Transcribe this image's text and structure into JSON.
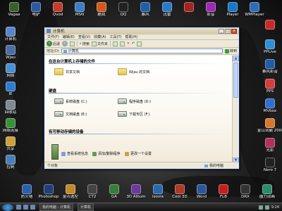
{
  "desktop": {
    "top_icons": [
      {
        "label": "Vagaa",
        "color": "#3a5f2e"
      },
      {
        "label": "电驴",
        "color": "#2c5aa0"
      },
      {
        "label": "Qvod",
        "color": "#c43c2a"
      },
      {
        "label": "MSN",
        "color": "#3b7fc4"
      },
      {
        "label": "酷我",
        "color": "#d35a1c"
      },
      {
        "label": "QQ",
        "color": "#222222"
      },
      {
        "label": "暴风",
        "color": "#1f5fa5"
      },
      {
        "label": "迅雷",
        "color": "#2a79c9"
      },
      {
        "label": "",
        "color": "#a3241e"
      },
      {
        "label": "影音",
        "color": "#9b2bb0"
      },
      {
        "label": "Player",
        "color": "#1878c8"
      },
      {
        "label": "WMPlayer",
        "color": "#2d6db5"
      }
    ],
    "left_icons": [
      {
        "label": "计算机",
        "color": "#5a86c8"
      },
      {
        "label": "Wjau",
        "color": "#4b6fa5"
      },
      {
        "label": "网络",
        "color": "#4a8fd0"
      },
      {
        "label": "IE",
        "color": "#2f7bd0"
      },
      {
        "label": "回收站",
        "color": "#7e8a94"
      },
      {
        "label": "网络连接",
        "color": "#3a8f3a"
      },
      {
        "label": "共享",
        "color": "#c9a23a"
      },
      {
        "label": "控制",
        "color": "#4d7eb8"
      }
    ],
    "right_icons": [
      {
        "label": "",
        "color": "#c42a2a"
      },
      {
        "label": "PPLive",
        "color": "#2e8fd8"
      },
      {
        "label": "暴风影音",
        "color": "#1f5fa5"
      },
      {
        "label": "PPS",
        "color": "#d63d3d"
      },
      {
        "label": "MVbox",
        "color": "#2f6fd0"
      },
      {
        "label": "金山词霸 2006",
        "color": "#d8782a"
      },
      {
        "label": "光影",
        "color": "#b03060"
      },
      {
        "label": "Nero 7",
        "color": "#222222"
      }
    ],
    "bottom_icons": [
      {
        "label": "防火墙",
        "color": "#2a5faa"
      },
      {
        "label": "Photoshop",
        "color": "#1d3f7a"
      },
      {
        "label": "金币选型",
        "color": "#c08a2a"
      },
      {
        "label": "CT2",
        "color": "#444444"
      },
      {
        "label": "GA",
        "color": "#3a7a3a"
      },
      {
        "label": "3D Album",
        "color": "#6a3a9a"
      },
      {
        "label": "Isovia",
        "color": "#2a6aaa"
      },
      {
        "label": "Cool 3D",
        "color": "#aa3a2a"
      },
      {
        "label": "Word",
        "color": "#2b579a"
      },
      {
        "label": "FLB",
        "color": "#c41e1e"
      },
      {
        "label": "DRX",
        "color": "#333333"
      },
      {
        "label": "魔力动画",
        "color": "#2a8a6a"
      }
    ]
  },
  "window": {
    "title": "计算机",
    "menu": [
      "文件(F)",
      "编辑(E)",
      "查看(V)",
      "收藏(A)",
      "工具(T)",
      "帮助(H)"
    ],
    "toolbar": {
      "back": "后退",
      "search": "搜索",
      "folders": "文件夹"
    },
    "address_label": "地址(D)",
    "address_value": "计算机",
    "go_label": "转到",
    "sections": {
      "stored_files": "在这台计算机上存储的文件",
      "hard_drives": "硬盘",
      "removable": "有可移动存储的设备"
    },
    "folders": [
      "共享文档",
      "Wjau 的文档"
    ],
    "drives": [
      "系统磁盘 (C:)",
      "程序磁盘 (D:)",
      "文档磁盘 (E:)",
      "下载专区 (F:)"
    ],
    "commands": [
      "查看系统信息",
      "添加/删除程序",
      "更改一个设置"
    ],
    "status_left": "个对象",
    "status_right": "我的电脑"
  },
  "taskbar": {
    "task": "我的电脑 - 计算机",
    "task2": "计算机",
    "clock": "9:24"
  }
}
